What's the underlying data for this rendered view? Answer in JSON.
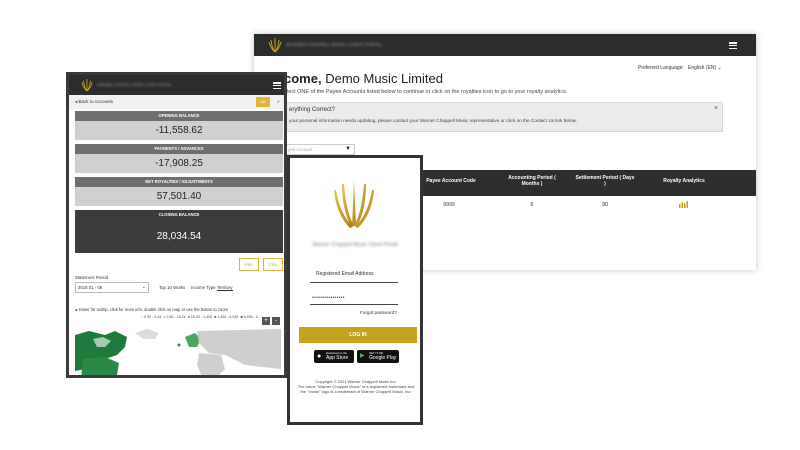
{
  "desktop": {
    "header": {
      "portal_name": "WARNER CHAPPELL MUSIC CLIENT PORTAL"
    },
    "preferred_language_label": "Preferred Language:",
    "language_value": "English (EN)",
    "welcome_prefix": "come,",
    "welcome_name": "Demo Music Limited",
    "subtitle": "elect ONE of the Payee Accounts listed below to continue or click on the royalties icon to go to your royalty analytics.",
    "alert": {
      "title": "erything Correct?",
      "body": "your personal information needs updating, please contact your Warner Chappell Music representative or click on the Contact Us link below.",
      "close": "×"
    },
    "filter_placeholder": "yee Account",
    "table": {
      "headers": [
        "Payee Account Code",
        "Accounting Period ( Months )",
        "Settlement Period ( Days )",
        "Royalty Analytics"
      ],
      "row": {
        "code": "9999",
        "accounting": "6",
        "settlement": "90"
      }
    }
  },
  "mobile_statement": {
    "portal_name": "WARNER CHAPPELL MUSIC CLIENT PORTAL",
    "back_label": "◂ Back to Accounts",
    "view_toggle": [
      "UK",
      "↗"
    ],
    "balances": [
      {
        "label": "OPENING BALANCE",
        "value": "-11,558.62"
      },
      {
        "label": "PAYMENTS / ADVANCES",
        "value": "-17,908.25"
      },
      {
        "label": "NET ROYALTIES / ADJUSTMENTS",
        "value": "57,501.40"
      },
      {
        "label": "CLOSING BALANCE",
        "value": "28,034.54"
      }
    ],
    "downloads": [
      "PDF",
      "CSV"
    ],
    "statement_period_label": "Statement Period",
    "statement_period_value": "2018 01 - 06",
    "tabs": [
      "Top 10 Works",
      "Income Type",
      "Territory"
    ],
    "map_hint": "Hover for tooltip, click for more info, double click on map or use the button to zoom",
    "legend": [
      "0.00 - 0.44",
      "2.60 - 16.21",
      "16.20 - 1,405",
      "1,405 - 6,935",
      "6,935 - 3"
    ],
    "zoom": [
      "+",
      "-"
    ]
  },
  "mobile_login": {
    "portal_name": "Warner Chappell Music Client Portal",
    "email_label": "Registered Email Address",
    "password_mask": "••••••••••••••••",
    "forgot_password": "Forgot password?",
    "login_button": "LOG IN",
    "app_store": "App Store",
    "google_play": "Google Play",
    "app_store_small": "Download on the",
    "google_play_small": "GET IT ON",
    "copyright_1": "Copyright © 2021 Warner Chappell Music Inc.",
    "copyright_2": "The name \"Warner Chappell Music\" is a registered trademark and",
    "copyright_3": "the \"crown\" logo is a trademark of Warner Chappell Music, Inc."
  },
  "colors": {
    "gold": "#c8a21c",
    "dark": "#2c2c2c",
    "green": "#1f7a3e"
  }
}
